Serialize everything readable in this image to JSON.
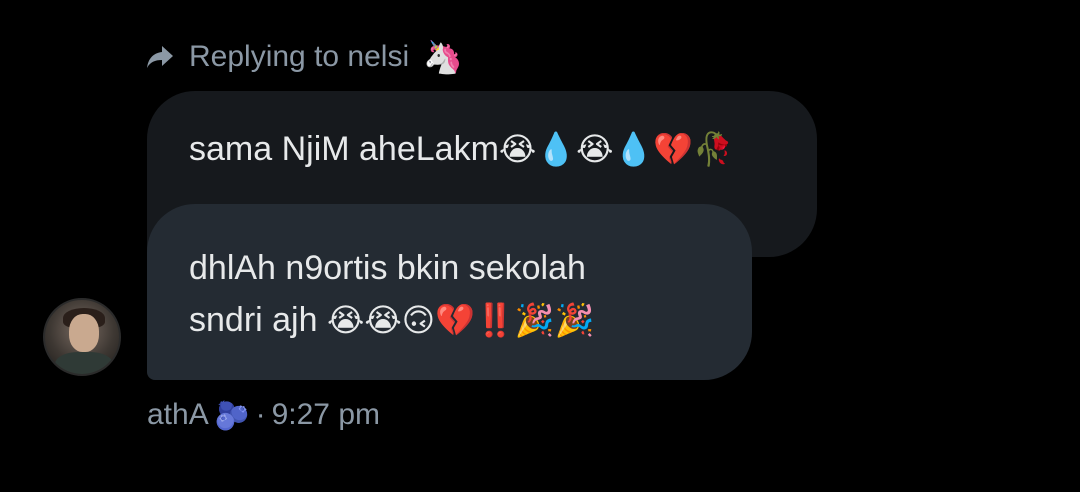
{
  "reply_header": {
    "text": "Replying to nelsi",
    "emoji": "🦄"
  },
  "quoted_message": {
    "text": "sama NjiM aheLakm",
    "emojis": "😭💧😭💧💔🥀"
  },
  "message": {
    "line1": "dhlAh n9ortis bkin sekolah",
    "line2_text": "sndri ajh ",
    "line2_emojis": "😭😭🙃💔‼️🎉🎉"
  },
  "meta": {
    "sender": "athA",
    "sender_emoji": "🫐",
    "separator": "·",
    "time": "9:27 pm"
  },
  "colors": {
    "background": "#000000",
    "bubble_main": "#242b33",
    "bubble_quoted": "#16191d",
    "muted_text": "#8b98a5",
    "text": "#e7e9ea"
  }
}
